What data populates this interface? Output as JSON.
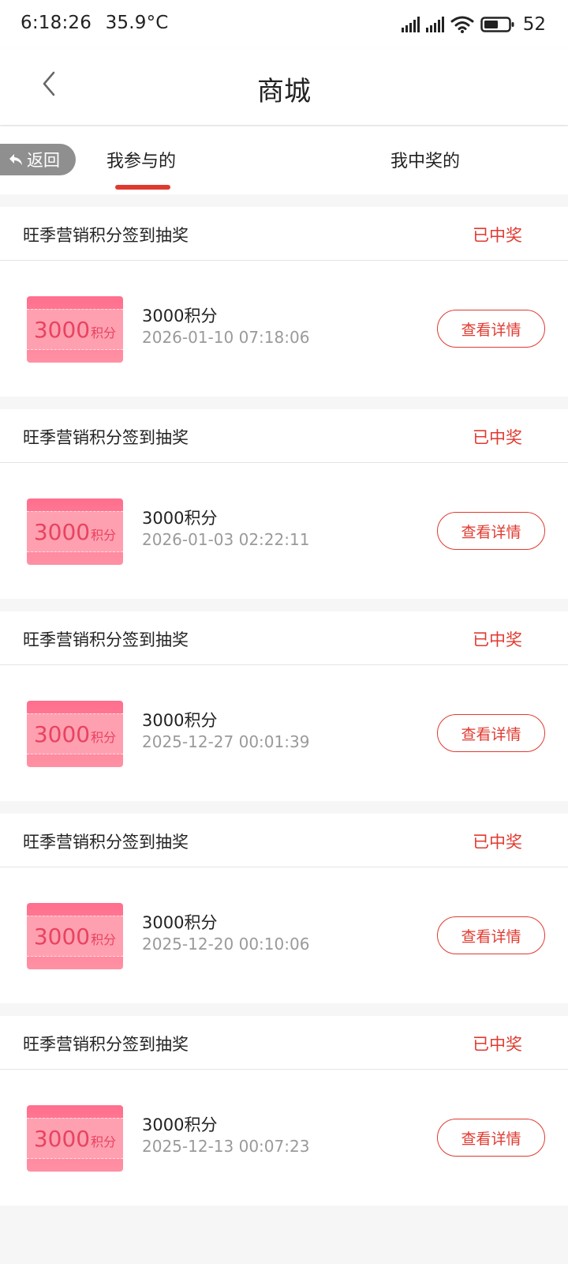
{
  "status_bar": {
    "time": "6:18:26",
    "temperature": "35.9°C",
    "battery": "52",
    "icons": [
      "signal-icon",
      "signal-icon",
      "wifi-icon",
      "battery-icon"
    ]
  },
  "nav": {
    "back_icon": "chevron-left-icon",
    "title": "商城"
  },
  "return_button": {
    "label": "返回",
    "icon": "return-arrow-icon"
  },
  "tabs": [
    {
      "label": "我参与的",
      "active": true
    },
    {
      "label": "我中奖的",
      "active": false
    }
  ],
  "colors": {
    "accent": "#e03a30",
    "coupon": "#ff7f96",
    "coupon_text": "#e8435f"
  },
  "items": [
    {
      "title": "旺季营销积分签到抽奖",
      "status": "已中奖",
      "coupon_number": "3000",
      "coupon_unit": "积分",
      "prize": "3000积分",
      "time": "2026-01-10 07:18:06",
      "button": "查看详情"
    },
    {
      "title": "旺季营销积分签到抽奖",
      "status": "已中奖",
      "coupon_number": "3000",
      "coupon_unit": "积分",
      "prize": "3000积分",
      "time": "2026-01-03 02:22:11",
      "button": "查看详情"
    },
    {
      "title": "旺季营销积分签到抽奖",
      "status": "已中奖",
      "coupon_number": "3000",
      "coupon_unit": "积分",
      "prize": "3000积分",
      "time": "2025-12-27 00:01:39",
      "button": "查看详情"
    },
    {
      "title": "旺季营销积分签到抽奖",
      "status": "已中奖",
      "coupon_number": "3000",
      "coupon_unit": "积分",
      "prize": "3000积分",
      "time": "2025-12-20 00:10:06",
      "button": "查看详情"
    },
    {
      "title": "旺季营销积分签到抽奖",
      "status": "已中奖",
      "coupon_number": "3000",
      "coupon_unit": "积分",
      "prize": "3000积分",
      "time": "2025-12-13 00:07:23",
      "button": "查看详情"
    }
  ]
}
